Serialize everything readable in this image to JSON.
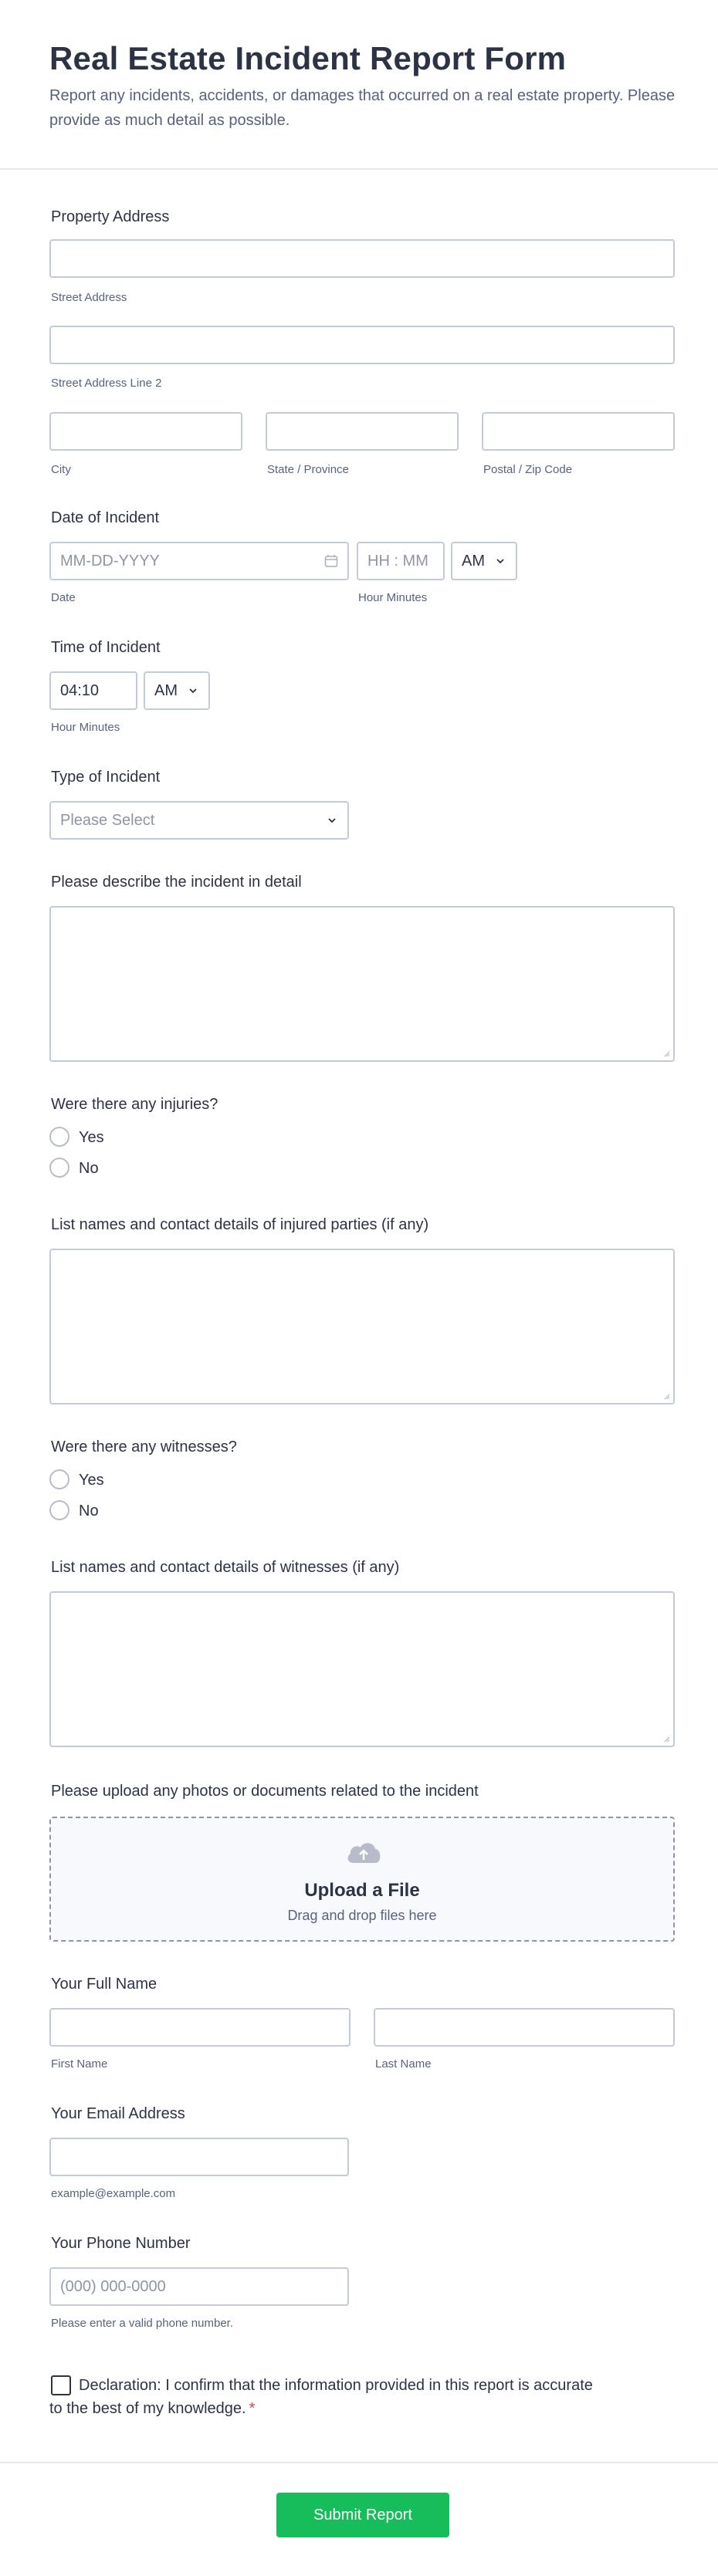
{
  "header": {
    "title": "Real Estate Incident Report Form",
    "subtitle": "Report any incidents, accidents, or damages that occurred on a real estate property. Please provide as much detail as possible."
  },
  "address": {
    "label": "Property Address",
    "street": "Street Address",
    "street2": "Street Address Line 2",
    "city": "City",
    "state": "State / Province",
    "postal": "Postal / Zip Code"
  },
  "date": {
    "label": "Date of Incident",
    "date_placeholder": "MM-DD-YYYY",
    "date_sublabel": "Date",
    "time_placeholder": "HH : MM",
    "time_sublabel": "Hour Minutes",
    "ampm": "AM"
  },
  "time": {
    "label": "Time of Incident",
    "value": "04:10",
    "ampm": "AM",
    "sublabel": "Hour Minutes"
  },
  "type": {
    "label": "Type of Incident",
    "placeholder": "Please Select"
  },
  "describe": {
    "label": "Please describe the incident in detail"
  },
  "injuries": {
    "label": "Were there any injuries?",
    "yes": "Yes",
    "no": "No"
  },
  "injured_parties": {
    "label": "List names and contact details of injured parties (if any)"
  },
  "witnesses": {
    "label": "Were there any witnesses?",
    "yes": "Yes",
    "no": "No"
  },
  "witness_details": {
    "label": "List names and contact details of witnesses (if any)"
  },
  "upload": {
    "label": "Please upload any photos or documents related to the incident",
    "title": "Upload a File",
    "subtitle": "Drag and drop files here",
    "icon": "cloud-upload-icon"
  },
  "name": {
    "label": "Your Full Name",
    "first": "First Name",
    "last": "Last Name"
  },
  "email": {
    "label": "Your Email Address",
    "sublabel": "example@example.com"
  },
  "phone": {
    "label": "Your Phone Number",
    "placeholder": "(000) 000-0000",
    "sublabel": "Please enter a valid phone number."
  },
  "declaration": {
    "text": "Declaration: I confirm that the information provided in this report is accurate to the best of my knowledge.",
    "required": "*"
  },
  "submit": {
    "label": "Submit Report"
  },
  "colors": {
    "accent": "#18bd5b",
    "text": "#2c3345",
    "border": "#c3cad8",
    "required": "#f23a3c"
  }
}
